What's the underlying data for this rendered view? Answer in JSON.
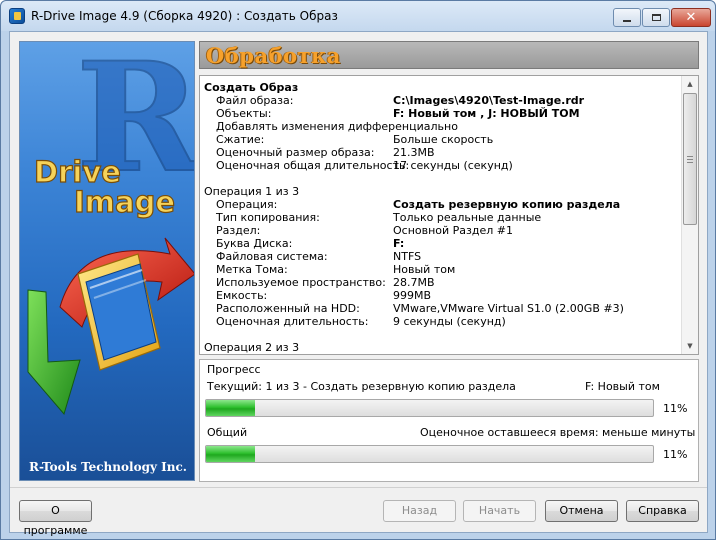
{
  "window": {
    "title": "R-Drive Image 4.9 (Сборка 4920) : Создать Образ",
    "icons": {
      "app": "r-drive-app-icon",
      "minimize": "minimize-icon",
      "maximize": "maximize-icon",
      "close": "close-icon"
    }
  },
  "banner": {
    "logo_letter": "R",
    "logo_line1": "Drive",
    "logo_line2": "Image",
    "caption": "R-Tools Technology Inc."
  },
  "header": {
    "title": "Обработка"
  },
  "summary": {
    "section1": {
      "title": "Создать Образ",
      "rows": [
        {
          "key": "Файл образа:",
          "value": "C:\\Images\\4920\\Test-Image.rdr",
          "bold": true
        },
        {
          "key": "Объекты:",
          "value": "F: Новый том , J: НОВЫЙ ТОМ",
          "bold": true
        },
        {
          "key": "Добавлять изменения дифференциально",
          "value": "",
          "bold": false
        },
        {
          "key": "Сжатие:",
          "value": "Больше скорость",
          "bold": false
        },
        {
          "key": "Оценочный размер образа:",
          "value": "21.3MB",
          "bold": false
        },
        {
          "key": "Оценочная общая длительность:",
          "value": "17 секунды (секунд)",
          "bold": false
        }
      ]
    },
    "section2": {
      "title": "Операция 1 из 3",
      "rows": [
        {
          "key": "Операция:",
          "value": "Создать резервную копию раздела",
          "bold": true
        },
        {
          "key": "Тип копирования:",
          "value": "Только реальные данные",
          "bold": false
        },
        {
          "key": "Раздел:",
          "value": "Основной Раздел #1",
          "bold": false
        },
        {
          "key": "Буква Диска:",
          "value": "F:",
          "bold": true
        },
        {
          "key": "Файловая система:",
          "value": "NTFS",
          "bold": false
        },
        {
          "key": "Метка Тома:",
          "value": "Новый том",
          "bold": false
        },
        {
          "key": "Используемое пространство:",
          "value": "28.7MB",
          "bold": false
        },
        {
          "key": "Емкость:",
          "value": "999MB",
          "bold": false
        },
        {
          "key": "Расположенный на HDD:",
          "value": "VMware,VMware Virtual S1.0 (2.00GB #3)",
          "bold": false
        },
        {
          "key": "Оценочная длительность:",
          "value": "9 секунды (секунд)",
          "bold": false
        }
      ]
    },
    "section3": {
      "title": "Операция 2 из 3"
    }
  },
  "progress": {
    "legend": "Прогресс",
    "current_label": "Текущий: 1 из 3 - Создать резервную копию раздела",
    "current_target": "F: Новый том",
    "current_percent": 11,
    "current_percent_text": "11%",
    "total_label": "Общий",
    "remaining_label": "Оценочное оставшееся время: меньше минуты",
    "total_percent": 11,
    "total_percent_text": "11%"
  },
  "buttons": {
    "about": "О программе",
    "back": "Назад",
    "start": "Начать",
    "cancel": "Отмена",
    "help": "Справка"
  }
}
